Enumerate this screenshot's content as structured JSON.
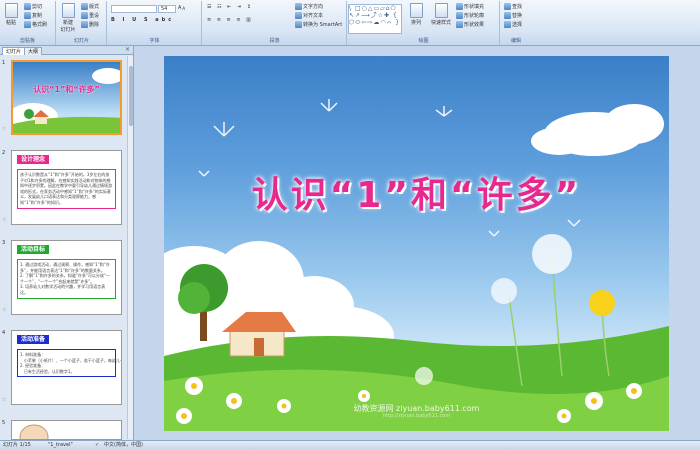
{
  "ribbon": {
    "clipboard": {
      "paste": "粘贴",
      "cut": "剪切",
      "copy": "复制",
      "format_painter": "格式刷",
      "label": "剪贴板"
    },
    "slides": {
      "new_slide": "新建\n幻灯片",
      "layout": "版式",
      "reset": "重设",
      "delete": "删除",
      "label": "幻灯片"
    },
    "font": {
      "size": "54",
      "label": "字体"
    },
    "paragraph": {
      "text_direction": "文字方向",
      "align_text": "对齐文本",
      "smartart": "转换为 SmartArt",
      "label": "段落"
    },
    "drawing": {
      "arrange": "排列",
      "quick_styles": "快速样式",
      "fill": "形状填充",
      "outline": "形状轮廓",
      "effects": "形状效果",
      "label": "绘图",
      "shapes_glyphs": "\\ □○△▭▱⌂⬠\n↖↗⟶⤴☆✚ {\n⬡⬭⇦⇨☁◠⌒ }"
    },
    "editing": {
      "find": "查找",
      "replace": "替换",
      "select": "选择",
      "label": "编辑"
    }
  },
  "panel": {
    "tabs": [
      "幻灯片",
      "大纲"
    ],
    "close": "×",
    "thumbs": [
      {
        "num": "1",
        "title": "认识“1”和“许多”"
      },
      {
        "num": "2",
        "header": "设计理念",
        "header_color": "#e8288c",
        "body": "孩子认识数是从“1”和“许多”开始的。3岁左右的孩子对1和许多的理解，在感知实践活动和对物体的感知中逐步积累。因此在教学中要引导幼儿通过情境游戏的形式，在家务活动中感知“1”和“许多”的实际意义，发展幼儿口语表达和分类观察能力，感知“1”和“许多”的知识。",
        "border": "#e8288c"
      },
      {
        "num": "3",
        "header": "活动目标",
        "header_color": "#1faa2e",
        "body": "1. 通过游戏活动，通过观察、操作，感知“1”和“许多”，并能用语言表达“1”和“许多”的数量关系。\n2. 了解“1”和许多的关系，知道“许多”可以分成“一个一个”，“一个一个”合起来就是“许多”。\n3. 培养幼儿对数学活动的兴趣，并学习用语言表达。",
        "border": "#1faa2e"
      },
      {
        "num": "4",
        "header": "活动准备",
        "header_color": "#1b2ecc",
        "body": "1. 材料准备：\n   小苹果（小纸片）、一个小篮子，若干小篮子，每幼儿一份。\n2. 经验准备：\n   已有生活经验，认识数字1。",
        "border": "#1b2ecc"
      },
      {
        "num": "5"
      }
    ]
  },
  "slide": {
    "title": "认识“1”和“许多”",
    "watermark": "幼教资源网 ziyuan.baby611.com",
    "watermark_sub": "http://ziyuan.baby611.com"
  },
  "status": {
    "slide_counter": "幻灯片 1/15",
    "theme": "\"1_travel\"",
    "language": "中文(简体，中国)"
  },
  "colors": {
    "title": "#e8288c",
    "selected_border": "#f29c2c"
  }
}
